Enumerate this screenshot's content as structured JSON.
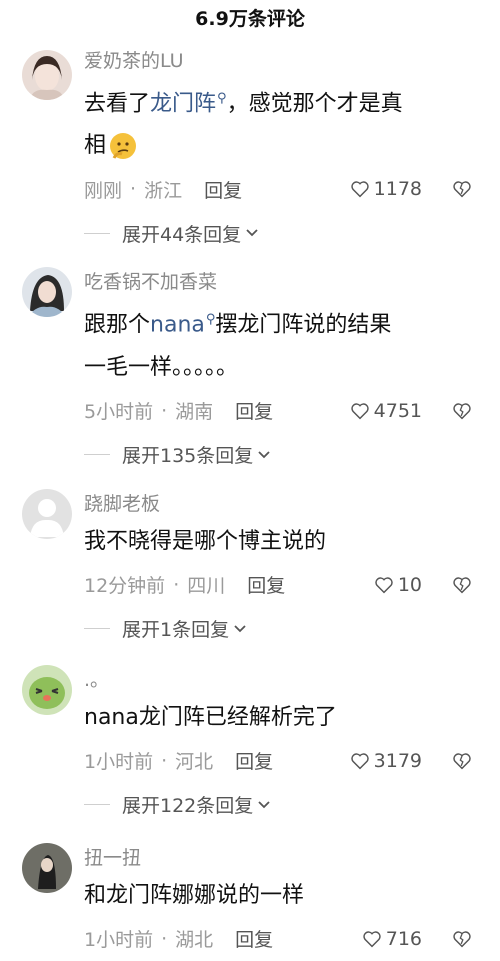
{
  "header": {
    "title": "6.9万条评论"
  },
  "comments": [
    {
      "user": "爱奶茶的LU",
      "text_pre": "去看了",
      "link": "龙门阵",
      "text_post": "，感觉那个才是真",
      "text_line2": "相",
      "time": "刚刚",
      "location": "浙江",
      "reply": "回复",
      "likes": "1178",
      "expand": "展开44条回复"
    },
    {
      "user": "吃香锅不加香菜",
      "text_pre": "跟那个",
      "link": "nana",
      "text_post": "摆龙门阵说的结果",
      "text_line2": "一毛一样。。。。。",
      "time": "5小时前",
      "location": "湖南",
      "reply": "回复",
      "likes": "4751",
      "expand": "展开135条回复"
    },
    {
      "user": "跷脚老板",
      "text": "我不晓得是哪个博主说的",
      "time": "12分钟前",
      "location": "四川",
      "reply": "回复",
      "likes": "10",
      "expand": "展开1条回复"
    },
    {
      "user": ".。",
      "text": "nana龙门阵已经解析完了",
      "time": "1小时前",
      "location": "河北",
      "reply": "回复",
      "likes": "3179",
      "expand": "展开122条回复"
    },
    {
      "user": "扭一扭",
      "text": "和龙门阵娜娜说的一样",
      "time": "1小时前",
      "location": "湖北",
      "reply": "回复",
      "likes": "716"
    }
  ],
  "meta_separator": "·",
  "icons": {
    "like": "heart-outline-icon",
    "dislike": "broken-heart-icon",
    "expand": "chevron-down-icon",
    "search": "search-icon"
  }
}
